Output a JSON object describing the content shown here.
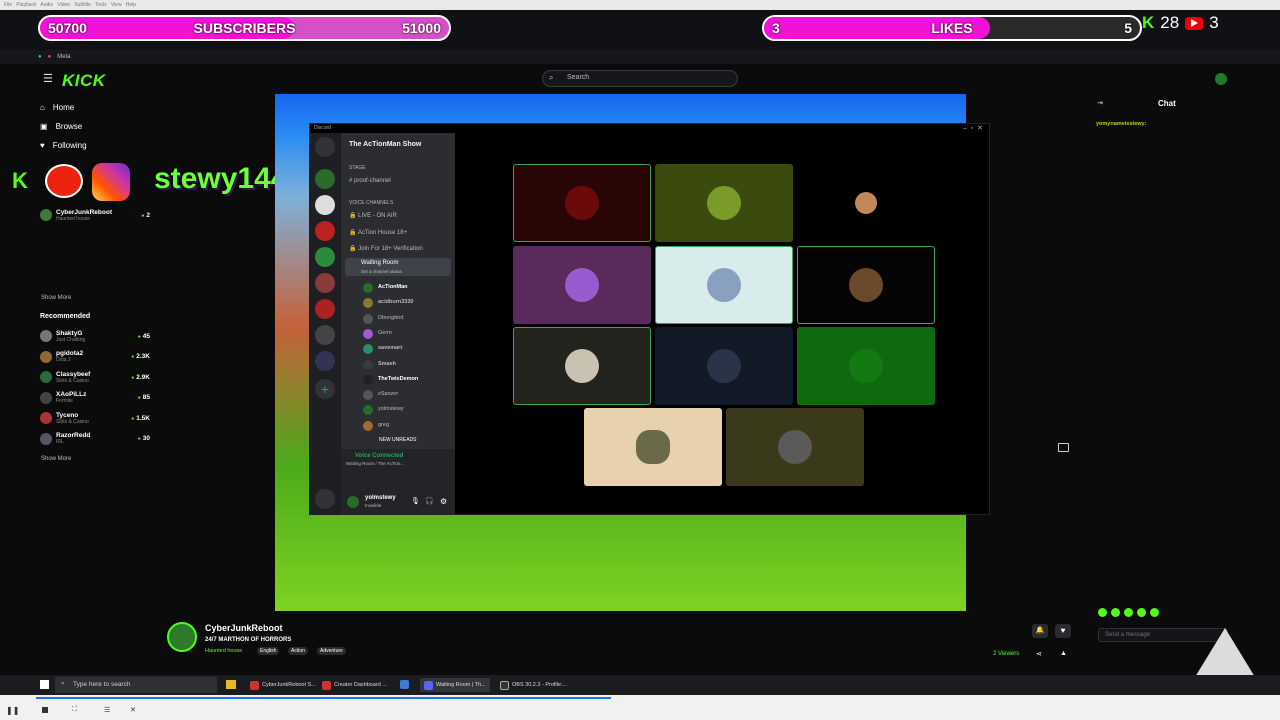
{
  "overlay": {
    "subs_start": "50700",
    "subs_label": "SUBSCRIBERS",
    "subs_goal": "51000",
    "likes_count": "3",
    "likes_label": "LIKES",
    "likes_goal": "5",
    "subs_progress": 0.62,
    "likes_progress": 0.6,
    "kick_count": "28",
    "youtube_count": "3",
    "username": "stewy144"
  },
  "browser": {
    "tab_meta_label": "Meta",
    "search_placeholder": "Search"
  },
  "kick": {
    "logo": "KICK",
    "nav": {
      "home": "Home",
      "browse": "Browse",
      "following": "Following"
    },
    "following_channels": [
      {
        "name": "CyberJunkReboot",
        "sub": "Haunted house",
        "viewers": "2"
      }
    ],
    "show_more": "Show More",
    "recommended_label": "Recommended",
    "recommended": [
      {
        "name": "ShaktyG",
        "sub": "Just Chatting",
        "viewers": "45"
      },
      {
        "name": "pgidota2",
        "sub": "Dota 2",
        "viewers": "2.3K"
      },
      {
        "name": "Classybeef",
        "sub": "Slots & Casino",
        "viewers": "2.9K"
      },
      {
        "name": "XAoPiLLz",
        "sub": "Fortnite",
        "viewers": "85"
      },
      {
        "name": "Tyceno",
        "sub": "Slots & Casino",
        "viewers": "1.5K"
      },
      {
        "name": "RazorRedd",
        "sub": "IRL",
        "viewers": "30"
      }
    ],
    "show_more_2": "Show More",
    "stream": {
      "channel": "CyberJunkReboot",
      "title": "24/7 MARTHON OF HORRORS",
      "category": "Haunted house",
      "tags": [
        "English",
        "Action",
        "Adventure"
      ],
      "viewers": "2 Viewers"
    },
    "chat": {
      "header": "Chat",
      "first_user": "yomynameisstewy:",
      "input_placeholder": "Send a message"
    }
  },
  "discord": {
    "app_title": "Discord",
    "server_name": "The AcTionMan Show",
    "stage_label": "STAGE",
    "text_channel": "proof-channel",
    "voice_label": "VOICE CHANNELS",
    "channels": [
      "LIVE - ON AIR",
      "AcTion House 18+",
      "Join For 18+ Verification"
    ],
    "waiting_room": "Waiting Room",
    "waiting_sub": "Set a channel status",
    "members": [
      "AcTionMan",
      "acidburn3330",
      "Dbongbird",
      "Germ",
      "savemart",
      "Smash",
      "TheTwixDemon",
      "xSanzer",
      "yolmstewy",
      "greg"
    ],
    "new_unreads": "NEW UNREADS",
    "voice_connected": "Voice Connected",
    "voice_sub": "Waiting Room / The AcTion...",
    "user_name": "yolmstewy",
    "user_status": "Invisible"
  },
  "taskbar": {
    "search": "Type here to search",
    "tasks": [
      "CyberJunkReboot S...",
      "Creator Dashboard ...",
      "Waiting Room | Th...",
      "OBS 30.2.3 - Profile:..."
    ]
  },
  "colors": {
    "kick_green": "#53fc18",
    "overlay_pink": "#f012d8",
    "discord_bg": "#2b2d31"
  }
}
